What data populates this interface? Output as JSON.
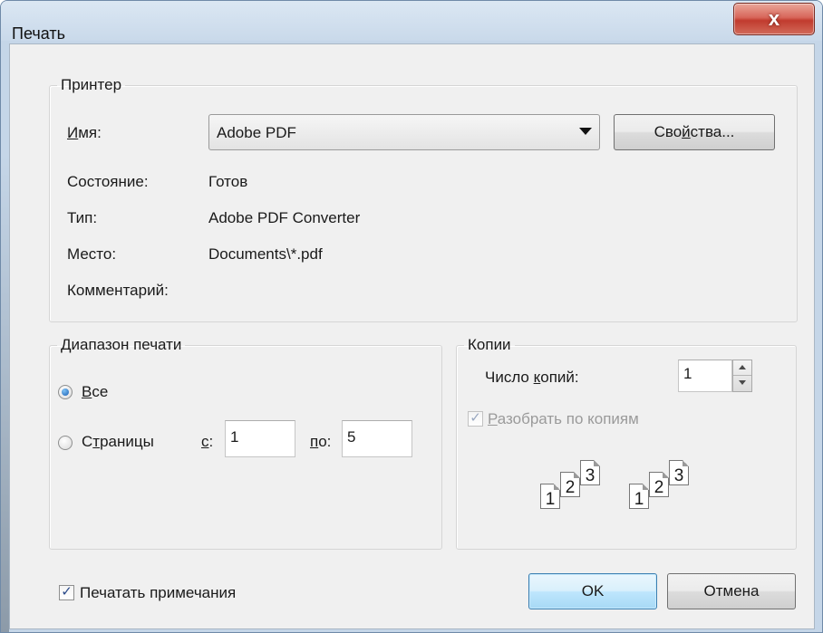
{
  "window": {
    "title": "Печать",
    "close_glyph": "x"
  },
  "printer": {
    "legend": "Принтер",
    "name_label_u": "И",
    "name_label_rest": "мя:",
    "name_value": "Adobe PDF",
    "properties_button_pre": "Сво",
    "properties_button_u": "й",
    "properties_button_post": "ства...",
    "status_label": "Состояние:",
    "status_value": "Готов",
    "type_label": "Тип:",
    "type_value": "Adobe PDF Converter",
    "where_label": "Место:",
    "where_value": "Documents\\*.pdf",
    "comment_label": "Комментарий:"
  },
  "range": {
    "legend": "Диапазон печати",
    "all_u": "В",
    "all_rest": "се",
    "all_selected": true,
    "pages_pre": "С",
    "pages_u": "т",
    "pages_post": "раницы",
    "from_u": "с",
    "from_rest": ":",
    "from_value": "1",
    "to_u": "п",
    "to_rest": "о:",
    "to_value": "5"
  },
  "copies": {
    "legend": "Копии",
    "count_label_pre": "Число ",
    "count_label_u": "к",
    "count_label_post": "опий:",
    "count_value": "1",
    "collate_u": "Р",
    "collate_rest": "азобрать по копиям",
    "collate_checked": true,
    "collate_enabled": false,
    "page_numbers": [
      "1",
      "2",
      "3"
    ]
  },
  "footer": {
    "print_comments_label": "Печатать примечания",
    "print_comments_checked": true,
    "ok_label": "OK",
    "cancel_label": "Отмена"
  },
  "icons": {
    "close": "close-icon",
    "dropdown": "chevron-down-icon",
    "spin_up": "spin-up-icon",
    "spin_down": "spin-down-icon",
    "collate_preview": "collate-pages-icon"
  },
  "colors": {
    "title_bar": "#c9d9ea",
    "dialog_bg": "#f0f0f0",
    "close_button": "#c13b2e",
    "default_button": "#bee6fd"
  }
}
